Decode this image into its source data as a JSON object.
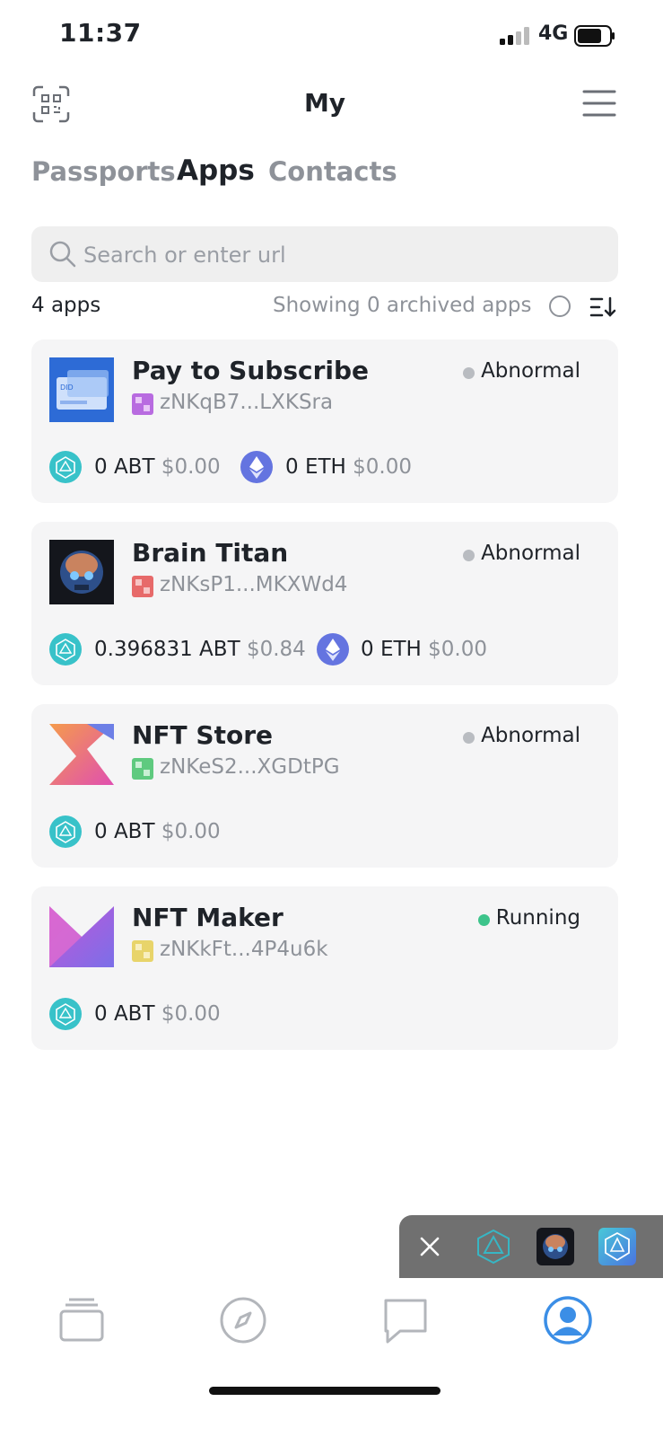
{
  "status_bar": {
    "time": "11:37",
    "network": "4G"
  },
  "header": {
    "title": "My"
  },
  "tabs": [
    {
      "label": "Passports",
      "active": false
    },
    {
      "label": "Apps",
      "active": true
    },
    {
      "label": "Contacts",
      "active": false
    }
  ],
  "search": {
    "placeholder": "Search or enter url",
    "value": ""
  },
  "summary": {
    "count": "4 apps",
    "archived": "Showing 0 archived apps"
  },
  "apps": [
    {
      "name": "Pay to Subscribe",
      "did": "zNKqB7...LXKSra",
      "status": "Abnormal",
      "tokens": [
        {
          "amount": "0 ABT",
          "usd": "$0.00"
        },
        {
          "amount": "0 ETH",
          "usd": "$0.00"
        }
      ]
    },
    {
      "name": "Brain Titan",
      "did": "zNKsP1...MKXWd4",
      "status": "Abnormal",
      "tokens": [
        {
          "amount": "0.396831 ABT",
          "usd": "$0.84"
        },
        {
          "amount": "0 ETH",
          "usd": "$0.00"
        }
      ]
    },
    {
      "name": "NFT Store",
      "did": "zNKeS2...XGDtPG",
      "status": "Abnormal",
      "tokens": [
        {
          "amount": "0 ABT",
          "usd": "$0.00"
        }
      ]
    },
    {
      "name": "NFT Maker",
      "did": "zNKkFt...4P4u6k",
      "status": "Running",
      "tokens": [
        {
          "amount": "0 ABT",
          "usd": "$0.00"
        }
      ]
    }
  ],
  "colors": {
    "status_abnormal": "#b9bcc1",
    "status_running": "#3dc48b",
    "accent": "#3b8ee6",
    "card_bg": "#f5f5f6"
  },
  "icons": {
    "bottom_tabs": [
      "cards-icon",
      "compass-icon",
      "chat-icon",
      "profile-icon"
    ]
  }
}
